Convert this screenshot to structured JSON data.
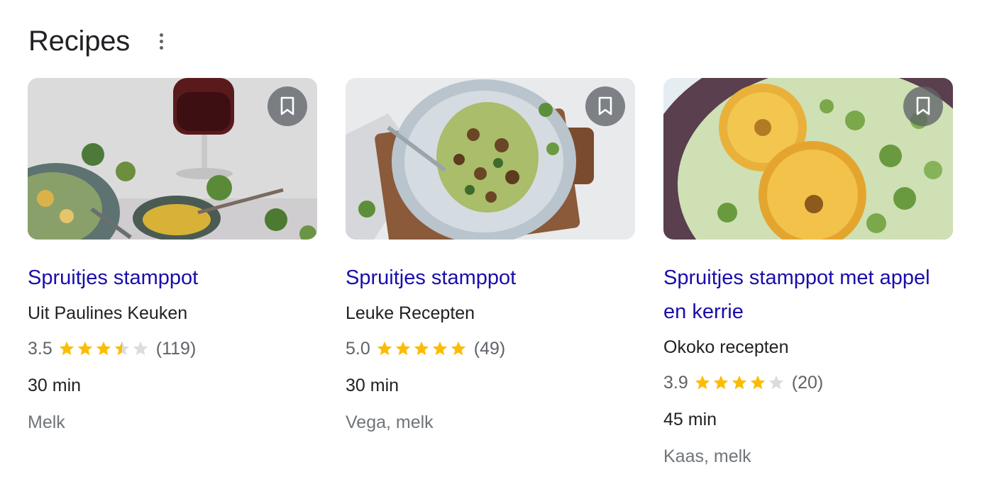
{
  "section": {
    "title": "Recipes",
    "more_icon": "more-vert-icon"
  },
  "colors": {
    "link": "#1a0dab",
    "star": "#fbbc04",
    "star_empty": "#dadce0"
  },
  "recipes": [
    {
      "name": "Spruitjes stamppot",
      "source": "Uit Paulines Keuken",
      "rating": "3.5",
      "rating_value": 3.5,
      "reviews": "(119)",
      "time": "30 min",
      "ingredients": "Melk"
    },
    {
      "name": "Spruitjes stamppot",
      "source": "Leuke Recepten",
      "rating": "5.0",
      "rating_value": 5.0,
      "reviews": "(49)",
      "time": "30 min",
      "ingredients": "Vega, melk"
    },
    {
      "name": "Spruitjes stamppot met appel en kerrie",
      "source": "Okoko recepten",
      "rating": "3.9",
      "rating_value": 3.9,
      "reviews": "(20)",
      "time": "45 min",
      "ingredients": "Kaas, melk"
    }
  ]
}
